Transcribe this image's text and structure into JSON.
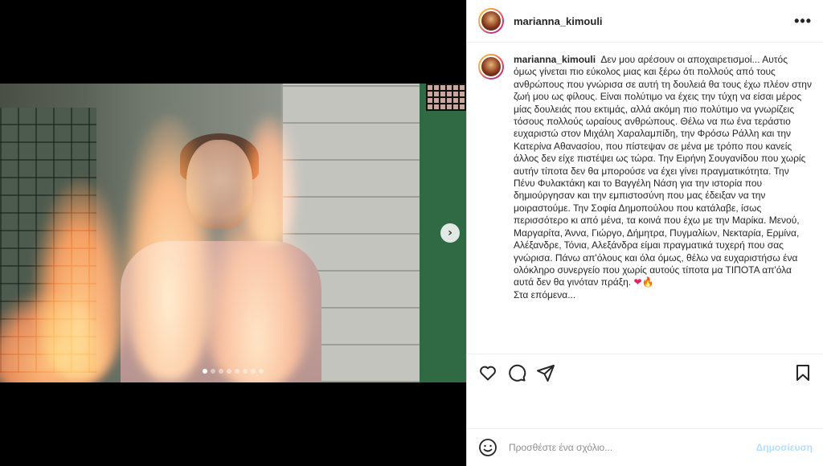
{
  "post": {
    "username": "marianna_kimouli",
    "caption_user": "marianna_kimouli",
    "caption_body": "Δεν μου αρέσουν οι αποχαιρετισμοί... Αυτός όμως γίνεται πιο εύκολος μιας και ξέρω ότι πολλούς από τους ανθρώπους που γνώρισα σε αυτή τη δουλειά θα τους έχω πλέον στην ζωή μου ως φίλους. Είναι πολύτιμο να έχεις την τύχη να είσαι μέρος μίας δουλειάς που εκτιμάς, αλλά ακόμη πιο πολύτιμο να γνωρίζεις τόσους πολλούς ωραίους ανθρώπους. Θέλω να πω ένα τεράστιο ευχαριστώ στον Μιχάλη Χαραλαμπίδη, την Φρόσω Ράλλη και την Κατερίνα Αθανασίου, που πίστεψαν σε μένα με τρόπο που κανείς άλλος δεν είχε πιστέψει ως τώρα. Την Ειρήνη Σουγανίδου που χωρίς αυτήν τίποτα δεν θα μπορούσε να έχει γίνει πραγματικότητα. Την Πένυ Φυλακτάκη και το Βαγγέλη Νάση για την ιστορία που δημιούργησαν και την εμπιστοσύνη που μας έδειξαν να την μοιραστούμε. Την Σοφία Δημοπούλου που κατάλαβε, ίσως περισσότερο κι από μένα, τα κοινά που έχω με την Μαρίκα. Μενού, Μαργαρίτα, Άννα, Γιώργο, Δήμητρα, Πυγμαλίων, Νεκταρία, Ερμίνα, Αλέξανδρε, Τόνια, Αλεξάνδρα είμαι πραγματικά τυχερή που σας γνώρισα. Πάνω απ'όλους και όλα όμως, θέλω να ευχαριστήσω ένα ολόκληρο συνεργείο που χωρίς αυτούς τίποτα μα ΤΙΠΟΤΑ απ'όλα αυτά δεν θα γινόταν πράξη.",
    "caption_emoji_heart": "❤",
    "caption_emoji_fire": "🔥",
    "caption_last_line": "Στα επόμενα...",
    "more_label": "•••",
    "carousel_count": 8,
    "carousel_active": 1,
    "next_label": "›"
  },
  "comment": {
    "placeholder": "Προσθέστε ένα σχόλιο...",
    "post_label": "Δημοσίευση"
  },
  "icons": [
    "heart-icon",
    "comment-icon",
    "share-icon",
    "bookmark-icon",
    "emoji-icon",
    "more-icon",
    "next-arrow-icon"
  ],
  "colors": {
    "post_disabled": "#b2dffc",
    "text": "#262626",
    "placeholder": "#8e8e8e"
  }
}
